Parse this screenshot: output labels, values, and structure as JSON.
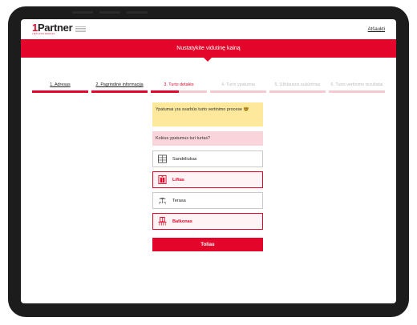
{
  "header": {
    "logo_text": "Partner",
    "logo_sub": "LIETUVOS BANKAS",
    "cancel_label": "Atšaukti"
  },
  "banner": {
    "title": "Nustatykite vidutinę kainą"
  },
  "steps": [
    {
      "label": "1. Adresas",
      "state": "done"
    },
    {
      "label": "2. Pagrindinė informacija",
      "state": "done"
    },
    {
      "label": "3. Turto detalės",
      "state": "active"
    },
    {
      "label": "4. Turto ypatumai",
      "state": "todo"
    },
    {
      "label": "5. Užklausos sukūrimas",
      "state": "todo"
    },
    {
      "label": "6. Turto vertinimo rezultatai",
      "state": "todo"
    }
  ],
  "form": {
    "notice": "Ypatumai yra svarbūs turto vertinimo procese 🤓",
    "question": "Kokius ypatumus turi turtas?",
    "options": [
      {
        "label": "Sandėliukas",
        "icon": "storage-icon",
        "selected": false
      },
      {
        "label": "Liftas",
        "icon": "elevator-icon",
        "selected": true
      },
      {
        "label": "Terasa",
        "icon": "terrace-icon",
        "selected": false
      },
      {
        "label": "Balkonas",
        "icon": "balcony-icon",
        "selected": true
      }
    ],
    "next_label": "Toliau"
  },
  "colors": {
    "accent": "#e3062a",
    "accent_light": "#f9d4da",
    "notice_bg": "#fde89c"
  }
}
